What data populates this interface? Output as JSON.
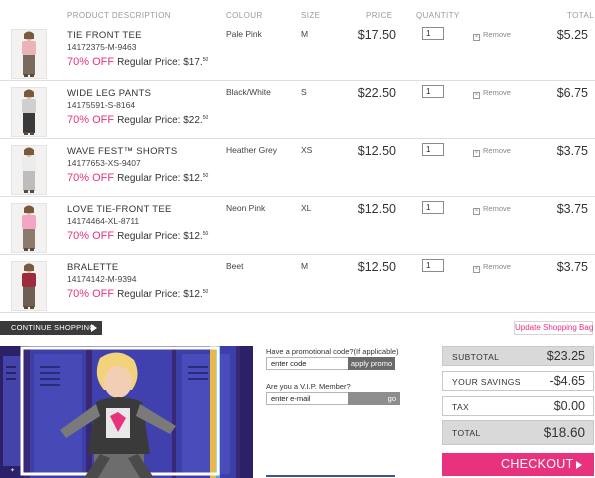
{
  "headers": {
    "product_description": "PRODUCT DESCRIPTION",
    "colour": "COLOUR",
    "size": "SIZE",
    "price": "PRICE",
    "quantity": "QUANTITY",
    "total": "TOTAL"
  },
  "remove_label": "Remove",
  "items": [
    {
      "name": "TIE FRONT TEE",
      "sku": "14172375-M-9463",
      "discount": "70% OFF",
      "regular_label": "Regular Price:",
      "regular_price": "$17.",
      "regular_cents": "50",
      "colour": "Pale Pink",
      "size": "M",
      "price": "$17.50",
      "quantity": "1",
      "total": "$5.25",
      "thumb_colors": {
        "top": "#e9b4b8",
        "bottom": "#7a6a5c"
      }
    },
    {
      "name": "WIDE LEG PANTS",
      "sku": "14175591-S-8164",
      "discount": "70% OFF",
      "regular_label": "Regular Price:",
      "regular_price": "$22.",
      "regular_cents": "50",
      "colour": "Black/White",
      "size": "S",
      "price": "$22.50",
      "quantity": "1",
      "total": "$6.75",
      "thumb_colors": {
        "top": "#cfcfcf",
        "bottom": "#3a3a3a"
      }
    },
    {
      "name": "WAVE FEST™ SHORTS",
      "sku": "14177653-XS-9407",
      "discount": "70% OFF",
      "regular_label": "Regular Price:",
      "regular_price": "$12.",
      "regular_cents": "50",
      "colour": "Heather Grey",
      "size": "XS",
      "price": "$12.50",
      "quantity": "1",
      "total": "$3.75",
      "thumb_colors": {
        "top": "#ececec",
        "bottom": "#bdbdbd"
      }
    },
    {
      "name": "LOVE TIE-FRONT TEE",
      "sku": "14174464-XL-8711",
      "discount": "70% OFF",
      "regular_label": "Regular Price:",
      "regular_price": "$12.",
      "regular_cents": "50",
      "colour": "Neon Pink",
      "size": "XL",
      "price": "$12.50",
      "quantity": "1",
      "total": "$3.75",
      "thumb_colors": {
        "top": "#f3a6c4",
        "bottom": "#8c7a6a"
      }
    },
    {
      "name": "BRALETTE",
      "sku": "14174142-M-9394",
      "discount": "70% OFF",
      "regular_label": "Regular Price:",
      "regular_price": "$12.",
      "regular_cents": "50",
      "colour": "Beet",
      "size": "M",
      "price": "$12.50",
      "quantity": "1",
      "total": "$3.75",
      "thumb_colors": {
        "top": "#9c2b3c",
        "bottom": "#6f5e52"
      }
    }
  ],
  "buttons": {
    "continue_shopping": "CONTINUE SHOPPING",
    "update_bag": "Update Shopping Bag",
    "apply_promo": "apply promo",
    "go": "go",
    "checkout": "CHECKOUT"
  },
  "promo": {
    "code_question": "Have a promotional code?(If applicable)",
    "code_placeholder": "enter code",
    "vip_question": "Are you a V.I.P. Member?",
    "email_placeholder": "enter e-mail"
  },
  "summary": {
    "subtotal_label": "SUBTOTAL",
    "subtotal": "$23.25",
    "savings_label": "YOUR SAVINGS",
    "savings": "-$4.65",
    "tax_label": "TAX",
    "tax": "$0.00",
    "total_label": "TOTAL",
    "total": "$18.60"
  },
  "colors": {
    "accent_pink": "#e8327e",
    "dark_button": "#3b3b3b",
    "banner_bg": "#392874",
    "locker_blue": "#3d3fa8"
  }
}
